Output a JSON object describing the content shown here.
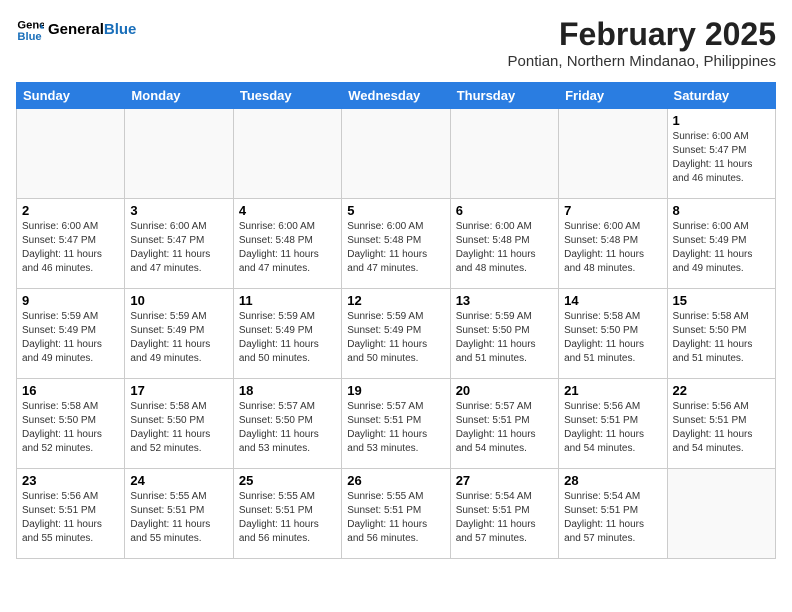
{
  "header": {
    "logo_line1": "General",
    "logo_line2": "Blue",
    "month": "February 2025",
    "location": "Pontian, Northern Mindanao, Philippines"
  },
  "weekdays": [
    "Sunday",
    "Monday",
    "Tuesday",
    "Wednesday",
    "Thursday",
    "Friday",
    "Saturday"
  ],
  "weeks": [
    [
      {
        "day": "",
        "info": ""
      },
      {
        "day": "",
        "info": ""
      },
      {
        "day": "",
        "info": ""
      },
      {
        "day": "",
        "info": ""
      },
      {
        "day": "",
        "info": ""
      },
      {
        "day": "",
        "info": ""
      },
      {
        "day": "1",
        "info": "Sunrise: 6:00 AM\nSunset: 5:47 PM\nDaylight: 11 hours and 46 minutes."
      }
    ],
    [
      {
        "day": "2",
        "info": "Sunrise: 6:00 AM\nSunset: 5:47 PM\nDaylight: 11 hours and 46 minutes."
      },
      {
        "day": "3",
        "info": "Sunrise: 6:00 AM\nSunset: 5:47 PM\nDaylight: 11 hours and 47 minutes."
      },
      {
        "day": "4",
        "info": "Sunrise: 6:00 AM\nSunset: 5:48 PM\nDaylight: 11 hours and 47 minutes."
      },
      {
        "day": "5",
        "info": "Sunrise: 6:00 AM\nSunset: 5:48 PM\nDaylight: 11 hours and 47 minutes."
      },
      {
        "day": "6",
        "info": "Sunrise: 6:00 AM\nSunset: 5:48 PM\nDaylight: 11 hours and 48 minutes."
      },
      {
        "day": "7",
        "info": "Sunrise: 6:00 AM\nSunset: 5:48 PM\nDaylight: 11 hours and 48 minutes."
      },
      {
        "day": "8",
        "info": "Sunrise: 6:00 AM\nSunset: 5:49 PM\nDaylight: 11 hours and 49 minutes."
      }
    ],
    [
      {
        "day": "9",
        "info": "Sunrise: 5:59 AM\nSunset: 5:49 PM\nDaylight: 11 hours and 49 minutes."
      },
      {
        "day": "10",
        "info": "Sunrise: 5:59 AM\nSunset: 5:49 PM\nDaylight: 11 hours and 49 minutes."
      },
      {
        "day": "11",
        "info": "Sunrise: 5:59 AM\nSunset: 5:49 PM\nDaylight: 11 hours and 50 minutes."
      },
      {
        "day": "12",
        "info": "Sunrise: 5:59 AM\nSunset: 5:49 PM\nDaylight: 11 hours and 50 minutes."
      },
      {
        "day": "13",
        "info": "Sunrise: 5:59 AM\nSunset: 5:50 PM\nDaylight: 11 hours and 51 minutes."
      },
      {
        "day": "14",
        "info": "Sunrise: 5:58 AM\nSunset: 5:50 PM\nDaylight: 11 hours and 51 minutes."
      },
      {
        "day": "15",
        "info": "Sunrise: 5:58 AM\nSunset: 5:50 PM\nDaylight: 11 hours and 51 minutes."
      }
    ],
    [
      {
        "day": "16",
        "info": "Sunrise: 5:58 AM\nSunset: 5:50 PM\nDaylight: 11 hours and 52 minutes."
      },
      {
        "day": "17",
        "info": "Sunrise: 5:58 AM\nSunset: 5:50 PM\nDaylight: 11 hours and 52 minutes."
      },
      {
        "day": "18",
        "info": "Sunrise: 5:57 AM\nSunset: 5:50 PM\nDaylight: 11 hours and 53 minutes."
      },
      {
        "day": "19",
        "info": "Sunrise: 5:57 AM\nSunset: 5:51 PM\nDaylight: 11 hours and 53 minutes."
      },
      {
        "day": "20",
        "info": "Sunrise: 5:57 AM\nSunset: 5:51 PM\nDaylight: 11 hours and 54 minutes."
      },
      {
        "day": "21",
        "info": "Sunrise: 5:56 AM\nSunset: 5:51 PM\nDaylight: 11 hours and 54 minutes."
      },
      {
        "day": "22",
        "info": "Sunrise: 5:56 AM\nSunset: 5:51 PM\nDaylight: 11 hours and 54 minutes."
      }
    ],
    [
      {
        "day": "23",
        "info": "Sunrise: 5:56 AM\nSunset: 5:51 PM\nDaylight: 11 hours and 55 minutes."
      },
      {
        "day": "24",
        "info": "Sunrise: 5:55 AM\nSunset: 5:51 PM\nDaylight: 11 hours and 55 minutes."
      },
      {
        "day": "25",
        "info": "Sunrise: 5:55 AM\nSunset: 5:51 PM\nDaylight: 11 hours and 56 minutes."
      },
      {
        "day": "26",
        "info": "Sunrise: 5:55 AM\nSunset: 5:51 PM\nDaylight: 11 hours and 56 minutes."
      },
      {
        "day": "27",
        "info": "Sunrise: 5:54 AM\nSunset: 5:51 PM\nDaylight: 11 hours and 57 minutes."
      },
      {
        "day": "28",
        "info": "Sunrise: 5:54 AM\nSunset: 5:51 PM\nDaylight: 11 hours and 57 minutes."
      },
      {
        "day": "",
        "info": ""
      }
    ]
  ]
}
